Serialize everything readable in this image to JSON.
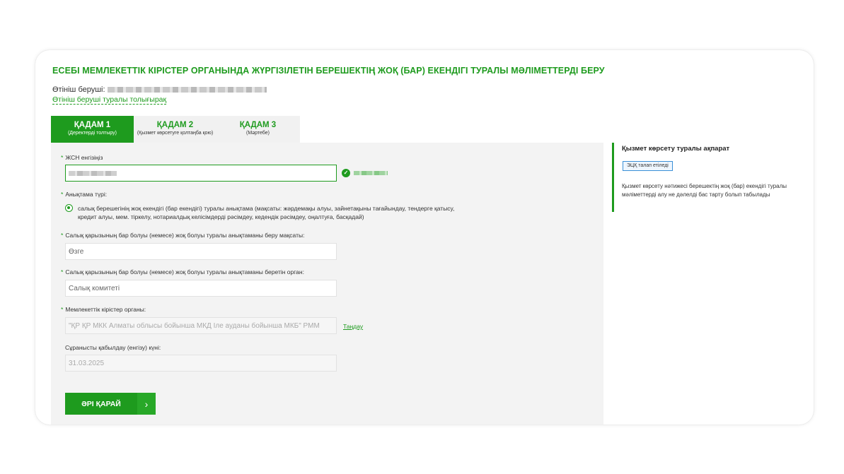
{
  "page": {
    "title": "ЕСЕБІ МЕМЛЕКЕТТІК КІРІСТЕР ОРГАНЫНДА ЖҮРГІЗІЛЕТІН БЕРЕШЕКТІҢ ЖОҚ (БАР) ЕКЕНДІГІ ТУРАЛЫ МӘЛІМЕТТЕРДІ БЕРУ",
    "applicant_label": "Өтініш беруші:",
    "applicant_link": "Өтініш беруші туралы толығырақ"
  },
  "tabs": [
    {
      "label": "ҚАДАМ 1",
      "sub": "(Деректерді толтыру)",
      "active": true
    },
    {
      "label": "ҚАДАМ 2",
      "sub": "(Қызмет көрсетуге қолтаңба қою)",
      "active": false
    },
    {
      "label": "ҚАДАМ 3",
      "sub": "(Мәртебе)",
      "active": false
    }
  ],
  "form": {
    "iin_label": "ЖСН енгізіңіз",
    "ref_type_label": "Анықтама түрі:",
    "ref_type_option": "салық берешегінің жоқ екендігі (бар екендігі) туралы анықтама (мақсаты: жәрдемақы алуы, зайнетақыны тағайындау, тендерге қатысу, кредит алуы, мем. тіркелу, нотариалдық келісімдерді рәсімдеу, кедендік рәсімдеу, оңалтуға, басқадай)",
    "purpose_label": "Салық қарызының бар болуы (немесе) жоқ болуы туралы анықтаманы беру мақсаты:",
    "purpose_value": "Өзге",
    "issuer_label": "Салық қарызының бар болуы (немесе) жоқ болуы туралы анықтаманы беретін орган:",
    "issuer_value": "Салық комитеті",
    "revenue_org_label": "Мемлекеттік кірістер органы:",
    "revenue_org_value": "\"ҚР ҚР МКК Алматы облысы бойынша МКД Іле ауданы бойынша МКБ\" РММ",
    "select_link": "Таңдау",
    "date_label": "Сұранысты қабылдау (енгізу) күні:",
    "date_value": "31.03.2025",
    "next_button": "ӘРІ ҚАРАЙ"
  },
  "info": {
    "title": "Қызмет көрсету туралы ақпарат",
    "badge": "ЭЦҚ талап етіледі",
    "text": "Қызмет көрсету нәтижесі берешектің жоқ (бар) екендігі туралы мәліметтерді алу не дәлелді бас тарту болып табылады"
  },
  "colors": {
    "accent": "#1e9b1e",
    "badge_border": "#3a8fd6"
  },
  "icons": {
    "check": "check-circle-icon",
    "next": "chevron-right-icon"
  }
}
